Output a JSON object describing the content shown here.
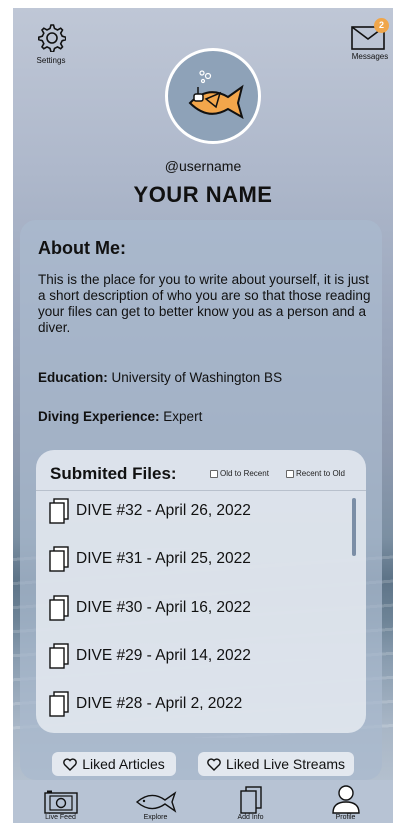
{
  "header": {
    "settings_label": "Settings",
    "messages_label": "Messages",
    "messages_badge": "2"
  },
  "profile": {
    "username": "@username",
    "name": "YOUR NAME"
  },
  "about": {
    "title": "About Me:",
    "text": "This is the place for you to write about yourself, it is just a short description of who you are so that those reading your files can get to better know you as a person and a diver.",
    "education_label": "Education:",
    "education_value": " University of Washington BS",
    "experience_label": "Diving Experience:",
    "experience_value": " Expert"
  },
  "files": {
    "title": "Submited Files:",
    "sort_options": [
      "Old to Recent",
      "Recent to Old"
    ],
    "items": [
      "DIVE #32 - April 26, 2022",
      "DIVE #31 - April 25, 2022",
      "DIVE #30 - April 16, 2022",
      "DIVE #29 - April 14, 2022",
      "DIVE #28 - April 2, 2022"
    ]
  },
  "links": {
    "liked_articles": "Liked Articles",
    "liked_streams": "Liked Live Streams"
  },
  "nav": {
    "items": [
      "Live Feed",
      "Explore",
      "Add Info",
      "Profile"
    ]
  },
  "colors": {
    "badge": "#f0a64a",
    "fish": "#f3a64b",
    "card": "#aab9cd",
    "panel": "#e1e6ee"
  }
}
